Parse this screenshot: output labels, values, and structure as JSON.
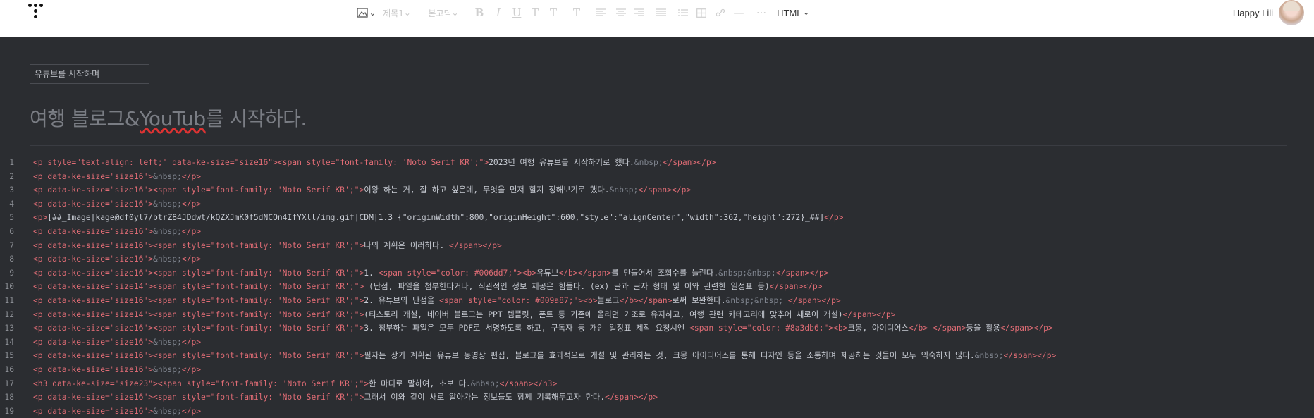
{
  "toolbar": {
    "image_icon": "image-icon",
    "paragraph_dd": "제목1",
    "font_dd": "본고딕",
    "bold": "B",
    "italic": "I",
    "underline": "U",
    "strike": "T",
    "text_color": "T",
    "bg_color": "T",
    "mode": "HTML"
  },
  "user": {
    "name": "Happy Lili"
  },
  "post": {
    "category": "유튜브를 시작하며",
    "title_before": "여행 블로그&",
    "title_err": "YouTub",
    "title_after": "를 시작하다."
  },
  "code_lines": [
    {
      "n": "1",
      "parts": [
        [
          "t",
          "<p style=\"text-align: left;\" data-ke-size=\"size16\"><span style=\"font-family: 'Noto Serif KR';\">"
        ],
        [
          "x",
          "2023년 여행 유튜브를 시작하기로 했다."
        ],
        [
          "e",
          "&nbsp;"
        ],
        [
          "t",
          "</span></p>"
        ]
      ]
    },
    {
      "n": "2",
      "parts": [
        [
          "t",
          "<p data-ke-size=\"size16\">"
        ],
        [
          "e",
          "&nbsp;"
        ],
        [
          "t",
          "</p>"
        ]
      ]
    },
    {
      "n": "3",
      "parts": [
        [
          "t",
          "<p data-ke-size=\"size16\"><span style=\"font-family: 'Noto Serif KR';\">"
        ],
        [
          "x",
          "이왕 하는 거, 잘 하고 싶은데, 무엇을 먼저 할지 정해보기로 했다."
        ],
        [
          "e",
          "&nbsp;"
        ],
        [
          "t",
          "</span></p>"
        ]
      ]
    },
    {
      "n": "4",
      "parts": [
        [
          "t",
          "<p data-ke-size=\"size16\">"
        ],
        [
          "e",
          "&nbsp;"
        ],
        [
          "t",
          "</p>"
        ]
      ]
    },
    {
      "n": "5",
      "parts": [
        [
          "t",
          "<p>"
        ],
        [
          "x",
          "[##_Image|kage@df0yl7/btrZ84JDdwt/kQZXJmK0f5dNCOn4IfYXll/img.gif|CDM|1.3|{\"originWidth\":800,\"originHeight\":600,\"style\":\"alignCenter\",\"width\":362,\"height\":272}_##]"
        ],
        [
          "t",
          "</p>"
        ]
      ]
    },
    {
      "n": "6",
      "parts": [
        [
          "t",
          "<p data-ke-size=\"size16\">"
        ],
        [
          "e",
          "&nbsp;"
        ],
        [
          "t",
          "</p>"
        ]
      ]
    },
    {
      "n": "7",
      "parts": [
        [
          "t",
          "<p data-ke-size=\"size16\"><span style=\"font-family: 'Noto Serif KR';\">"
        ],
        [
          "x",
          "나의 계획은 이러하다. "
        ],
        [
          "t",
          "</span></p>"
        ]
      ]
    },
    {
      "n": "8",
      "parts": [
        [
          "t",
          "<p data-ke-size=\"size16\">"
        ],
        [
          "e",
          "&nbsp;"
        ],
        [
          "t",
          "</p>"
        ]
      ]
    },
    {
      "n": "9",
      "parts": [
        [
          "t",
          "<p data-ke-size=\"size16\"><span style=\"font-family: 'Noto Serif KR';\">"
        ],
        [
          "x",
          "1. "
        ],
        [
          "t",
          "<span style=\"color: #006dd7;\"><b>"
        ],
        [
          "x",
          "유튜브"
        ],
        [
          "t",
          "</b></span>"
        ],
        [
          "x",
          "를 만들어서 조회수를 늘린다."
        ],
        [
          "e",
          "&nbsp;&nbsp;"
        ],
        [
          "t",
          "</span></p>"
        ]
      ]
    },
    {
      "n": "10",
      "parts": [
        [
          "t",
          "<p data-ke-size=\"size14\"><span style=\"font-family: 'Noto Serif KR';\">"
        ],
        [
          "x",
          " (단점, 파일을 첨부한다거나, 직관적인 정보 제공은 힘들다. (ex) 글과 글자 형태 및 이와 관련한 일정표 등)"
        ],
        [
          "t",
          "</span></p>"
        ]
      ]
    },
    {
      "n": "11",
      "parts": [
        [
          "t",
          "<p data-ke-size=\"size16\"><span style=\"font-family: 'Noto Serif KR';\">"
        ],
        [
          "x",
          "2. 유튜브의 단점을 "
        ],
        [
          "t",
          "<span style=\"color: #009a87;\"><b>"
        ],
        [
          "x",
          "블로그"
        ],
        [
          "t",
          "</b></span>"
        ],
        [
          "x",
          "로써 보완한다."
        ],
        [
          "e",
          "&nbsp;&nbsp; "
        ],
        [
          "t",
          "</span></p>"
        ]
      ]
    },
    {
      "n": "12",
      "parts": [
        [
          "t",
          "<p data-ke-size=\"size14\"><span style=\"font-family: 'Noto Serif KR';\">"
        ],
        [
          "x",
          "(티스토리 개설, 네이버 블로그는 PPT 템플릿, 폰트 등 기존에 올리던 기조로 유지하고, 여행 관련 카테고리에 맞추어 새로이 개설)"
        ],
        [
          "t",
          "</span></p>"
        ]
      ]
    },
    {
      "n": "13",
      "parts": [
        [
          "t",
          "<p data-ke-size=\"size16\"><span style=\"font-family: 'Noto Serif KR';\">"
        ],
        [
          "x",
          "3. 첨부하는 파일은 모두 PDF로 서명하도록 하고, 구독자 등 개인 일정표 제작 요청시엔 "
        ],
        [
          "t",
          "<span style=\"color: #8a3db6;\"><b>"
        ],
        [
          "x",
          "크몽, 아이디어스"
        ],
        [
          "t",
          "</b> </span>"
        ],
        [
          "x",
          "등을 활용"
        ],
        [
          "t",
          "</span></p>"
        ]
      ]
    },
    {
      "n": "14",
      "parts": [
        [
          "t",
          "<p data-ke-size=\"size16\">"
        ],
        [
          "e",
          "&nbsp;"
        ],
        [
          "t",
          "</p>"
        ]
      ]
    },
    {
      "n": "15",
      "parts": [
        [
          "t",
          "<p data-ke-size=\"size16\"><span style=\"font-family: 'Noto Serif KR';\">"
        ],
        [
          "x",
          "필자는 상기 계획된 유튜브 동영상 편집, 블로그를 효과적으로 개설 및 관리하는 것, 크몽 아이디어스를 통해 디자인 등을 소통하며 제공하는 것들이 모두 익숙하지 않다."
        ],
        [
          "e",
          "&nbsp;"
        ],
        [
          "t",
          "</span></p>"
        ]
      ]
    },
    {
      "n": "16",
      "parts": [
        [
          "t",
          "<p data-ke-size=\"size16\">"
        ],
        [
          "e",
          "&nbsp;"
        ],
        [
          "t",
          "</p>"
        ]
      ]
    },
    {
      "n": "17",
      "parts": [
        [
          "t",
          "<h3 data-ke-size=\"size23\"><span style=\"font-family: 'Noto Serif KR';\">"
        ],
        [
          "x",
          "한 마디로 말하여, 초보 다."
        ],
        [
          "e",
          "&nbsp;"
        ],
        [
          "t",
          "</span></h3>"
        ]
      ]
    },
    {
      "n": "18",
      "parts": [
        [
          "t",
          "<p data-ke-size=\"size16\"><span style=\"font-family: 'Noto Serif KR';\">"
        ],
        [
          "x",
          "그래서 이와 같이 새로 알아가는 정보들도 함께 기록해두고자 한다."
        ],
        [
          "t",
          "</span></p>"
        ]
      ]
    },
    {
      "n": "19",
      "parts": [
        [
          "t",
          "<p data-ke-size=\"size16\">"
        ],
        [
          "e",
          "&nbsp;"
        ],
        [
          "t",
          "</p>"
        ]
      ]
    }
  ]
}
